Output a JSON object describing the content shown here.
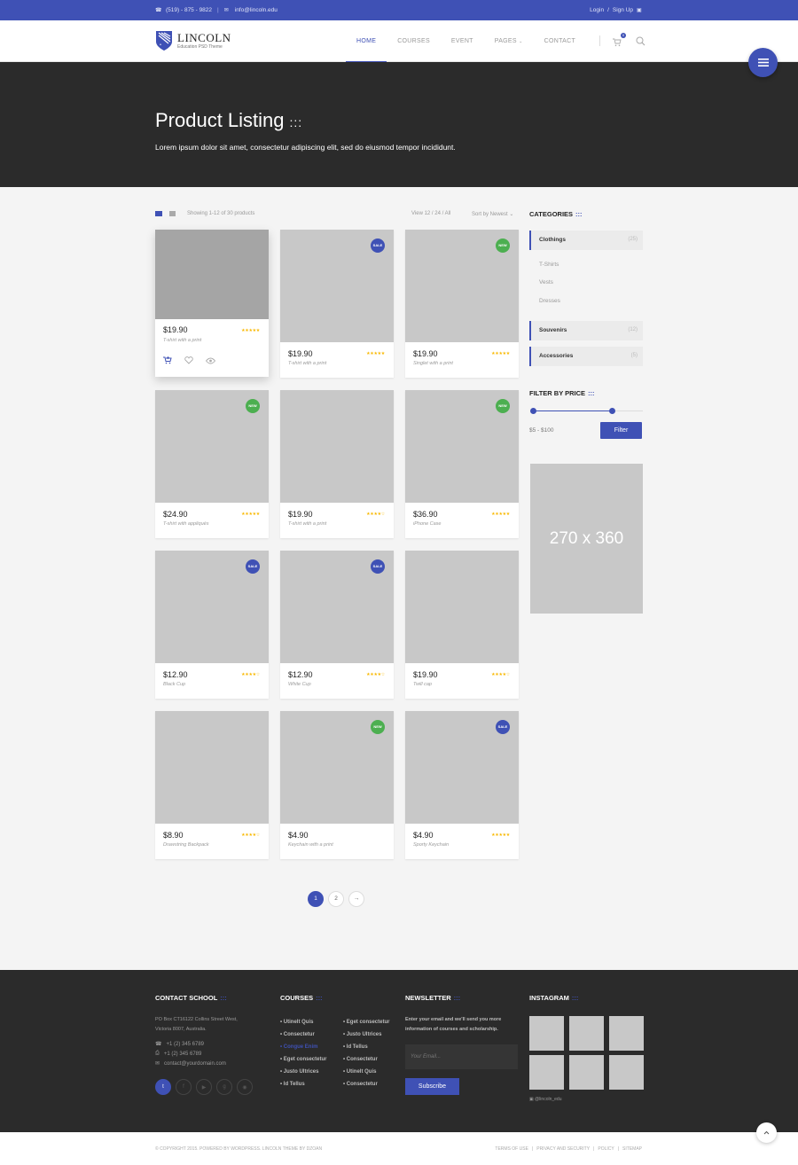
{
  "topbar": {
    "phone": "(519) - 875 - 9822",
    "email": "info@lincoln.edu",
    "login": "Login",
    "signup": "Sign Up"
  },
  "brand": {
    "name": "LINCOLN",
    "tagline": "Education PSD Theme",
    "accent": "#3f51b5"
  },
  "nav": {
    "items": [
      "HOME",
      "COURSES",
      "EVENT",
      "PAGES",
      "CONTACT"
    ],
    "active": "HOME",
    "cart_count": "0"
  },
  "hero": {
    "title": "Product Listing",
    "dots": ":::",
    "subtitle": "Lorem ipsum dolor sit amet, consectetur adipiscing elit, sed do eiusmod tempor incididunt."
  },
  "toolbar": {
    "showing": "Showing 1-12 of 30 products",
    "view": "View 12 / 24 / All",
    "sort": "Sort by Newest"
  },
  "products": [
    {
      "price": "$19.90",
      "name": "T-shirt with a print",
      "badge": "",
      "rating": 5
    },
    {
      "price": "$19.90",
      "name": "T-shirt with a print",
      "badge": "SALE",
      "rating": 5
    },
    {
      "price": "$19.90",
      "name": "Singlet with a print",
      "badge": "NEW",
      "rating": 5
    },
    {
      "price": "$24.90",
      "name": "T-shirt with appliqués",
      "badge": "NEW",
      "rating": 5
    },
    {
      "price": "$19.90",
      "name": "T-shirt with a print",
      "badge": "",
      "rating": 4
    },
    {
      "price": "$36.90",
      "name": "iPhone Case",
      "badge": "NEW",
      "rating": 5
    },
    {
      "price": "$12.90",
      "name": "Black Cup",
      "badge": "SALE",
      "rating": 4
    },
    {
      "price": "$12.90",
      "name": "White Cup",
      "badge": "SALE",
      "rating": 4
    },
    {
      "price": "$19.90",
      "name": "Twill cap",
      "badge": "",
      "rating": 4
    },
    {
      "price": "$8.90",
      "name": "Drawstring Backpack",
      "badge": "",
      "rating": 4
    },
    {
      "price": "$4.90",
      "name": "Keychain with a print",
      "badge": "NEW",
      "rating": 0
    },
    {
      "price": "$4.90",
      "name": "Sporty Keychain",
      "badge": "SALE",
      "rating": 5
    }
  ],
  "pagination": {
    "pages": [
      "1",
      "2"
    ],
    "active": "1"
  },
  "sidebar": {
    "categories_title": "CATEGORIES",
    "categories": [
      {
        "name": "Clothings",
        "count": "(25)"
      },
      {
        "name": "Souvenirs",
        "count": "(12)"
      },
      {
        "name": "Accessories",
        "count": "(5)"
      }
    ],
    "subcategories": [
      "T-Shirts",
      "Vests",
      "Dresses"
    ],
    "price_title": "FILTER BY PRICE",
    "price_range": "$5 - $100",
    "price_low": 0,
    "price_high": 0.72,
    "filter_label": "Filter",
    "ad_label": "270 x 360"
  },
  "footer": {
    "contact_title": "CONTACT SCHOOL",
    "address_line1": "PO Box CT16122 Collins Street West,",
    "address_line2": "Victoria 8007, Australia.",
    "phone": "+1 (2) 345 6789",
    "fax": "+1 (2) 345 6789",
    "email": "contact@yourdomain.com",
    "courses_title": "COURSES",
    "courses_col1": [
      "Utinelt Quis",
      "Consectetur",
      "Congue Enim",
      "Eget consectetur",
      "Justo Ultrices",
      "Id Tellus"
    ],
    "courses_col2": [
      "Eget consectetur",
      "Justo Ultrices",
      "Id Tellus",
      "Consectetur",
      "Utinelt Quis",
      "Consectetur"
    ],
    "highlight_course": "Congue Enim",
    "newsletter_title": "NEWSLETTER",
    "newsletter_text_1": "Enter your email and we'll send you more",
    "newsletter_text_2": "information of courses and scholarship.",
    "email_placeholder": "Your Email...",
    "subscribe_label": "Subscribe",
    "instagram_title": "INSTAGRAM",
    "instagram_handle": "@lincoln_edu",
    "copyright": "© COPYRIGHT 2015. POWERED BY WORDPRESS. LINCOLN THEME BY DZOAN",
    "links": [
      "TERMS OF USE",
      "PRIVACY AND SECURITY",
      "POLICY",
      "SITEMAP"
    ]
  }
}
